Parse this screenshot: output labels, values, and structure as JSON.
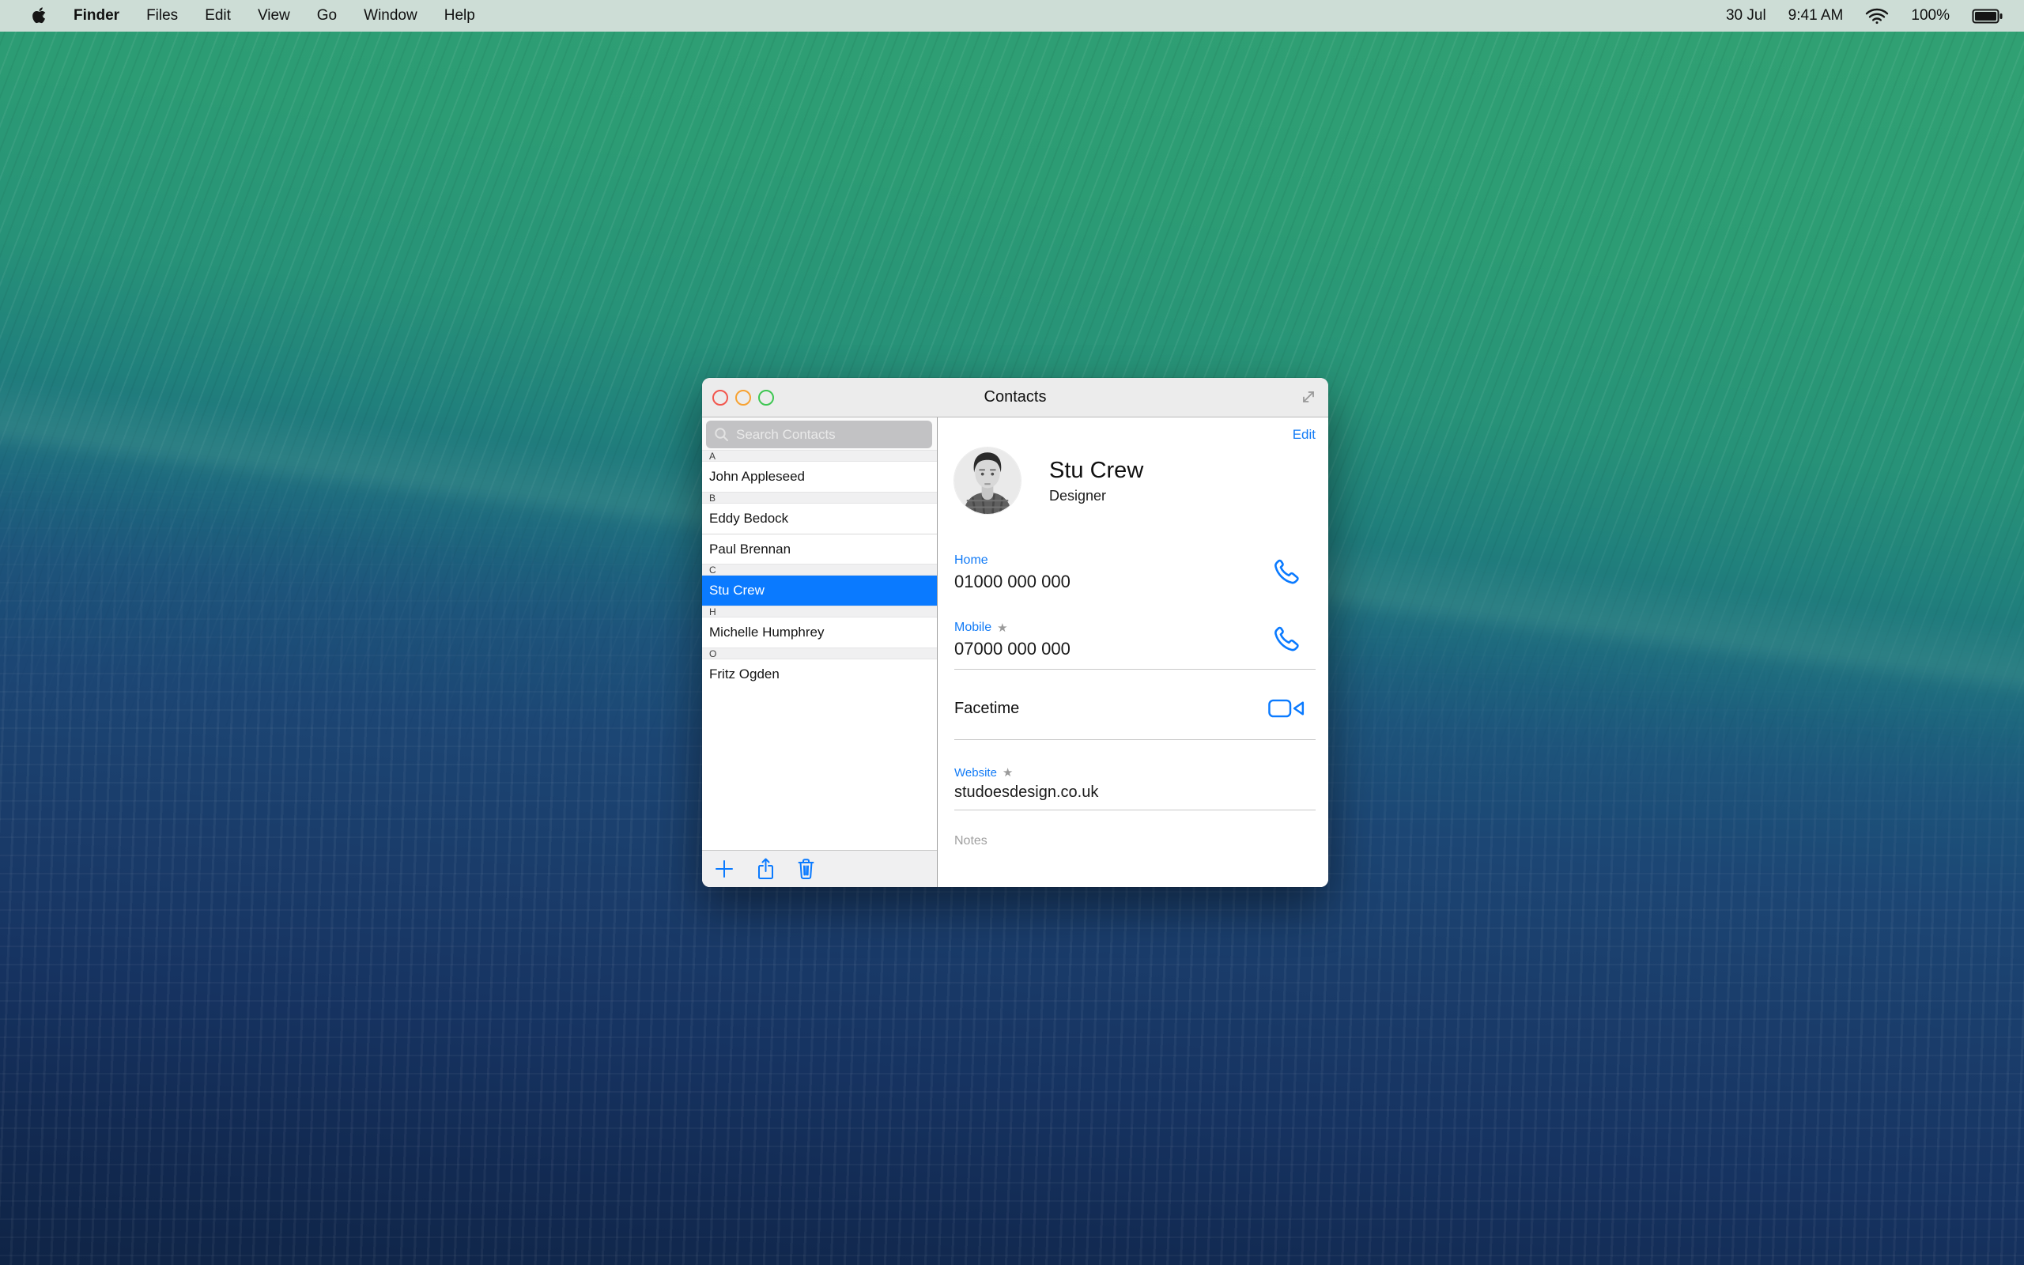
{
  "menu_bar": {
    "apple_icon": "apple-logo",
    "items": [
      "Finder",
      "Files",
      "Edit",
      "View",
      "Go",
      "Window",
      "Help"
    ],
    "status": {
      "date": "30 Jul",
      "time": "9:41 AM",
      "wifi_icon": "wifi-full",
      "battery_percent": "100%",
      "battery_icon": "battery-full"
    }
  },
  "window": {
    "title": "Contacts",
    "traffic_lights": [
      "close",
      "minimize",
      "zoom"
    ],
    "expand_icon": "expand-diagonal-arrows",
    "sidebar": {
      "search_placeholder": "Search Contacts",
      "sections": [
        {
          "letter": "A",
          "contacts": [
            {
              "name": "John Appleseed",
              "selected": false
            }
          ]
        },
        {
          "letter": "B",
          "contacts": [
            {
              "name": "Eddy Bedock",
              "selected": false
            },
            {
              "name": "Paul Brennan",
              "selected": false
            }
          ]
        },
        {
          "letter": "C",
          "contacts": [
            {
              "name": "Stu Crew",
              "selected": true
            }
          ]
        },
        {
          "letter": "H",
          "contacts": [
            {
              "name": "Michelle Humphrey",
              "selected": false
            }
          ]
        },
        {
          "letter": "O",
          "contacts": [
            {
              "name": "Fritz Ogden",
              "selected": false
            }
          ]
        }
      ],
      "toolbar": [
        "add-contact",
        "share-contact",
        "delete-contact"
      ]
    },
    "detail": {
      "edit_label": "Edit",
      "name": "Stu Crew",
      "role": "Designer",
      "fields": [
        {
          "label": "Home",
          "starred": false,
          "value": "01000 000 000",
          "icon": "phone"
        },
        {
          "label": "Mobile",
          "starred": true,
          "value": "07000 000 000",
          "icon": "phone"
        }
      ],
      "facetime_label": "Facetime",
      "facetime_icon": "video-camera",
      "website": {
        "label": "Website",
        "starred": true,
        "value": "studoesdesign.co.uk"
      },
      "notes_placeholder": "Notes"
    }
  },
  "glyphs": {
    "star": "★"
  },
  "colors": {
    "accent_blue": "#0a7aff",
    "selection_blue": "#0a7aff",
    "menu_bar_tint": "#cdddd6",
    "titlebar_gray": "#ececec",
    "wallpaper_green": "#2c9c74",
    "wallpaper_blue": "#16305a"
  }
}
